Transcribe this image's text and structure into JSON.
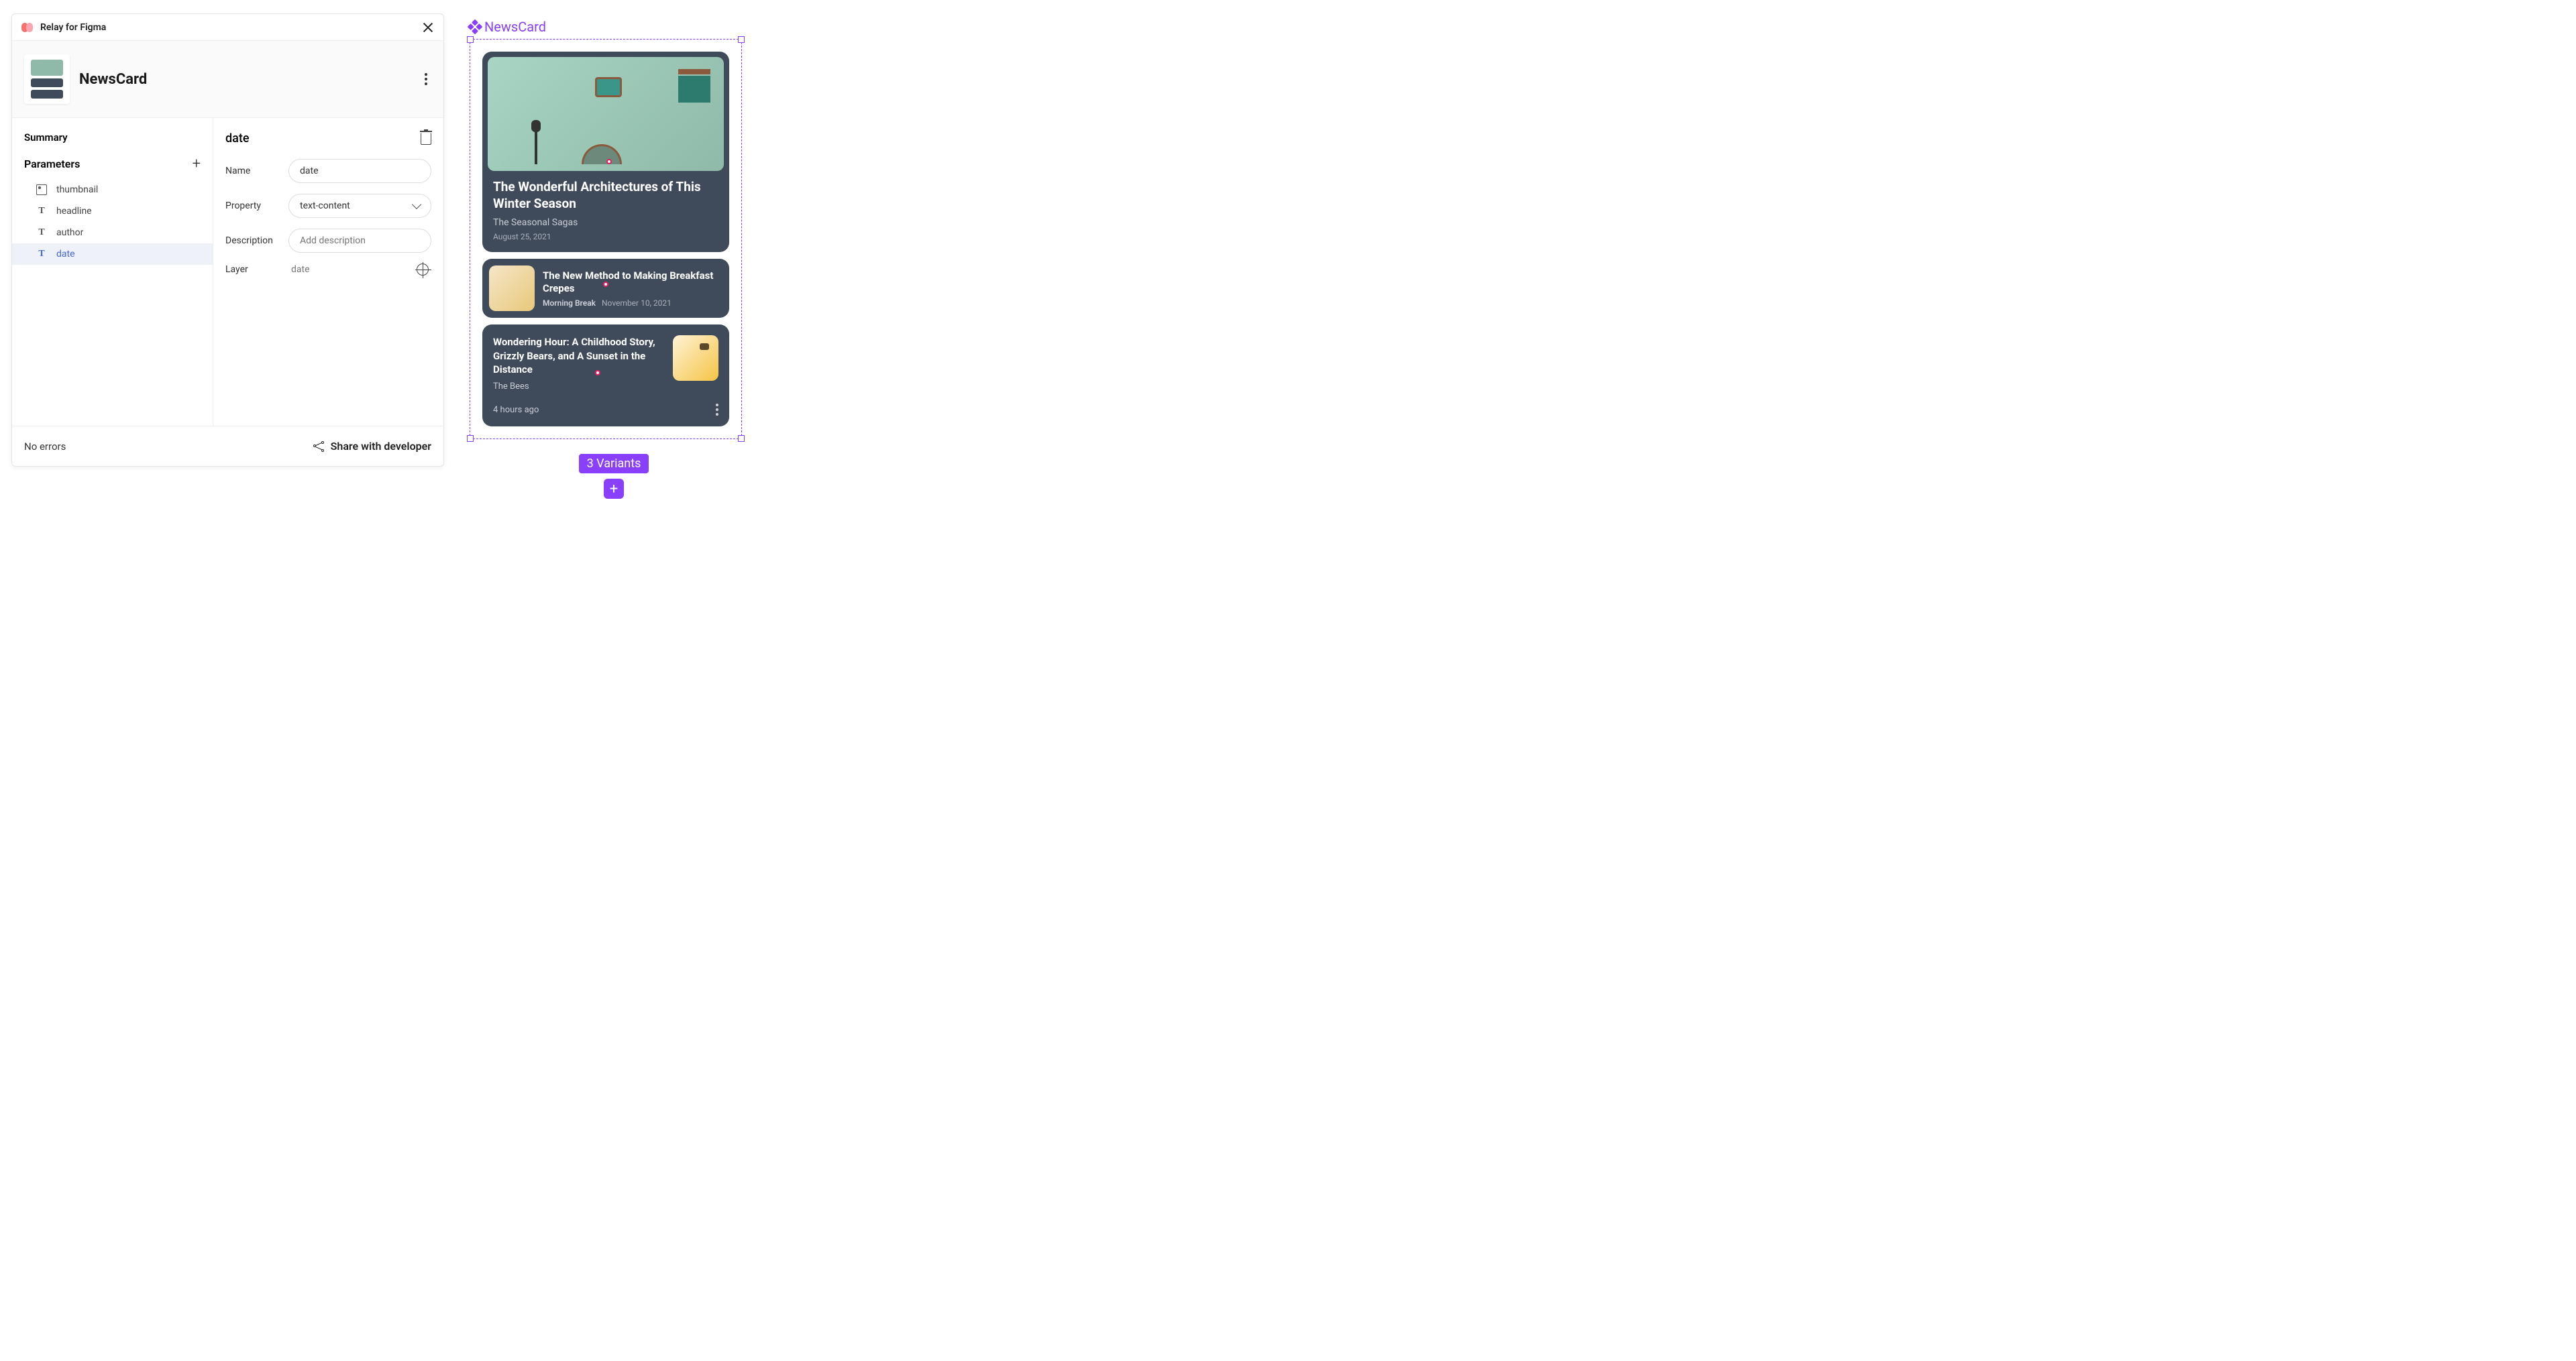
{
  "plugin": {
    "name": "Relay for Figma"
  },
  "component": {
    "name": "NewsCard"
  },
  "sidebar": {
    "summary_label": "Summary",
    "parameters_label": "Parameters",
    "params": [
      {
        "icon": "image",
        "name": "thumbnail"
      },
      {
        "icon": "text",
        "name": "headline"
      },
      {
        "icon": "text",
        "name": "author"
      },
      {
        "icon": "text",
        "name": "date"
      }
    ]
  },
  "detail": {
    "title": "date",
    "fields": {
      "name_label": "Name",
      "name_value": "date",
      "property_label": "Property",
      "property_value": "text-content",
      "description_label": "Description",
      "description_placeholder": "Add description",
      "layer_label": "Layer",
      "layer_value": "date"
    }
  },
  "footer": {
    "status": "No errors",
    "share_label": "Share with developer"
  },
  "canvas": {
    "frame_label": "NewsCard",
    "variants_label": "3 Variants",
    "cards": [
      {
        "headline": "The Wonderful Architectures of This Winter Season",
        "author": "The Seasonal Sagas",
        "date": "August 25, 2021"
      },
      {
        "headline": "The New Method to Making Breakfast Crepes",
        "author": "Morning Break",
        "date": "November 10, 2021"
      },
      {
        "headline": "Wondering Hour: A Childhood Story, Grizzly Bears, and A Sunset in the Distance",
        "author": "The Bees",
        "date": "4 hours ago"
      }
    ]
  }
}
